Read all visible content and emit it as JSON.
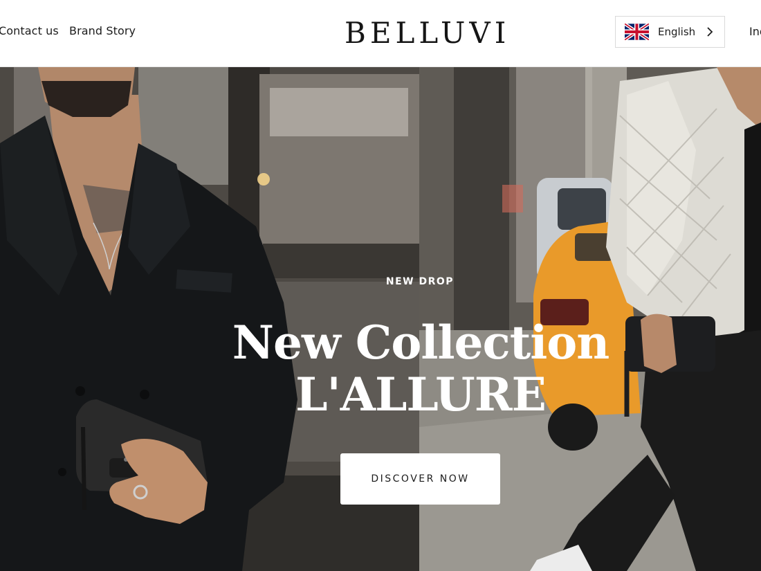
{
  "header": {
    "nav_left": [
      "Contact us",
      "Brand Story"
    ],
    "logo": "BELLUVI",
    "language": {
      "flag_icon": "uk-flag-icon",
      "label": "English",
      "chevron_icon": "chevron-right-icon"
    },
    "nav_right_partial": "Ind"
  },
  "hero": {
    "eyebrow": "NEW DROP",
    "title_line1": "New Collection",
    "title_line2": "L'ALLURE",
    "cta_label": "DISCOVER NOW"
  },
  "colors": {
    "text_dark": "#1a1a1a",
    "border": "#d9d9d9",
    "hero_text": "#ffffff",
    "taxi": "#e99a2a"
  }
}
